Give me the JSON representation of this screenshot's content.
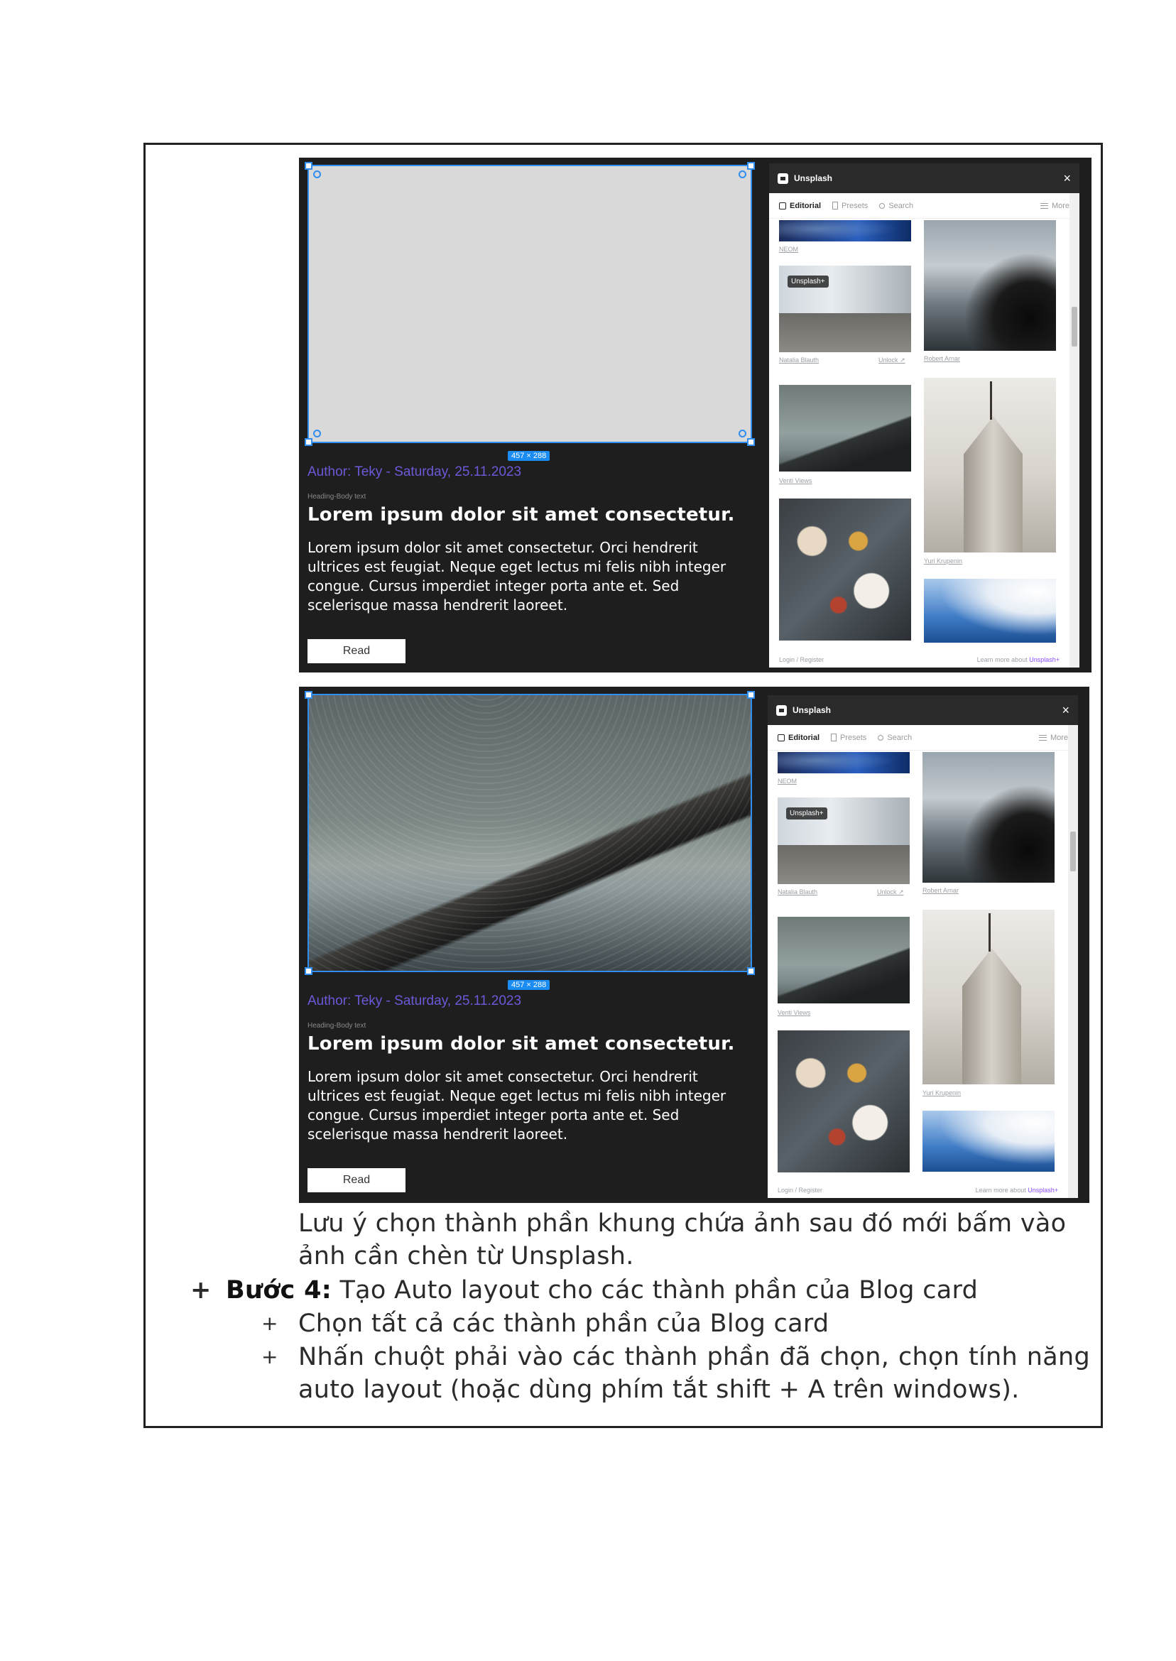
{
  "shots": [
    {
      "size_badge": "457 × 288",
      "author": "Author: Teky - Saturday, 25.11.2023",
      "layer_tag": "Heading-Body text",
      "heading": "Lorem ipsum dolor sit amet consectetur.",
      "body": "Lorem ipsum dolor sit amet consectetur. Orci hendrerit ultrices est feugiat. Neque eget lectus mi felis nibh integer congue. Cursus imperdiet integer porta ante et. Sed scelerisque massa hendrerit laoreet.",
      "button": "Read",
      "image_state": "placeholder"
    },
    {
      "size_badge": "457 × 288",
      "author": "Author: Teky - Saturday, 25.11.2023",
      "layer_tag": "Heading-Body text",
      "heading": "Lorem ipsum dolor sit amet consectetur.",
      "body": "Lorem ipsum dolor sit amet consectetur. Orci hendrerit ultrices est feugiat. Neque eget lectus mi felis nibh integer congue. Cursus imperdiet integer porta ante et. Sed scelerisque massa hendrerit laoreet.",
      "button": "Read",
      "image_state": "star-trail photo"
    }
  ],
  "plugin": {
    "title": "Unsplash",
    "close_icon": "close-icon",
    "tabs": [
      "Editorial",
      "Presets",
      "Search"
    ],
    "more": "More",
    "captions": {
      "neom": "NEOM",
      "natalia": "Natalia Blauth",
      "unlock": "Unlock ↗",
      "robert": "Robert Arnar",
      "venti": "Venti Views",
      "yuri": "Yuri Krupenin"
    },
    "plus_badge": "Unsplash+",
    "footer_left": "Login / Register",
    "footer_right": "Learn more about",
    "footer_brand": "Unsplash+"
  },
  "text": {
    "note": "Lưu ý chọn thành phần khung chứa ảnh sau đó mới bấm vào ảnh cần chèn từ Unsplash.",
    "step_label": "Bước 4:",
    "step_text": " Tạo Auto layout cho các thành phần của Blog card",
    "sub1": "Chọn tất cả các thành phần của Blog card",
    "sub2": "Nhấn chuột phải vào các thành phần đã chọn, chọn tính năng auto layout (hoặc dùng phím tắt shift + A trên windows).",
    "bullet": "+",
    "sub_bullet": "+"
  },
  "colors": {
    "selection": "#2f8ef0",
    "author": "#6a5ad8",
    "panel_bg": "#1e1e1e",
    "unsplash_plus": "#8a4dfc"
  }
}
